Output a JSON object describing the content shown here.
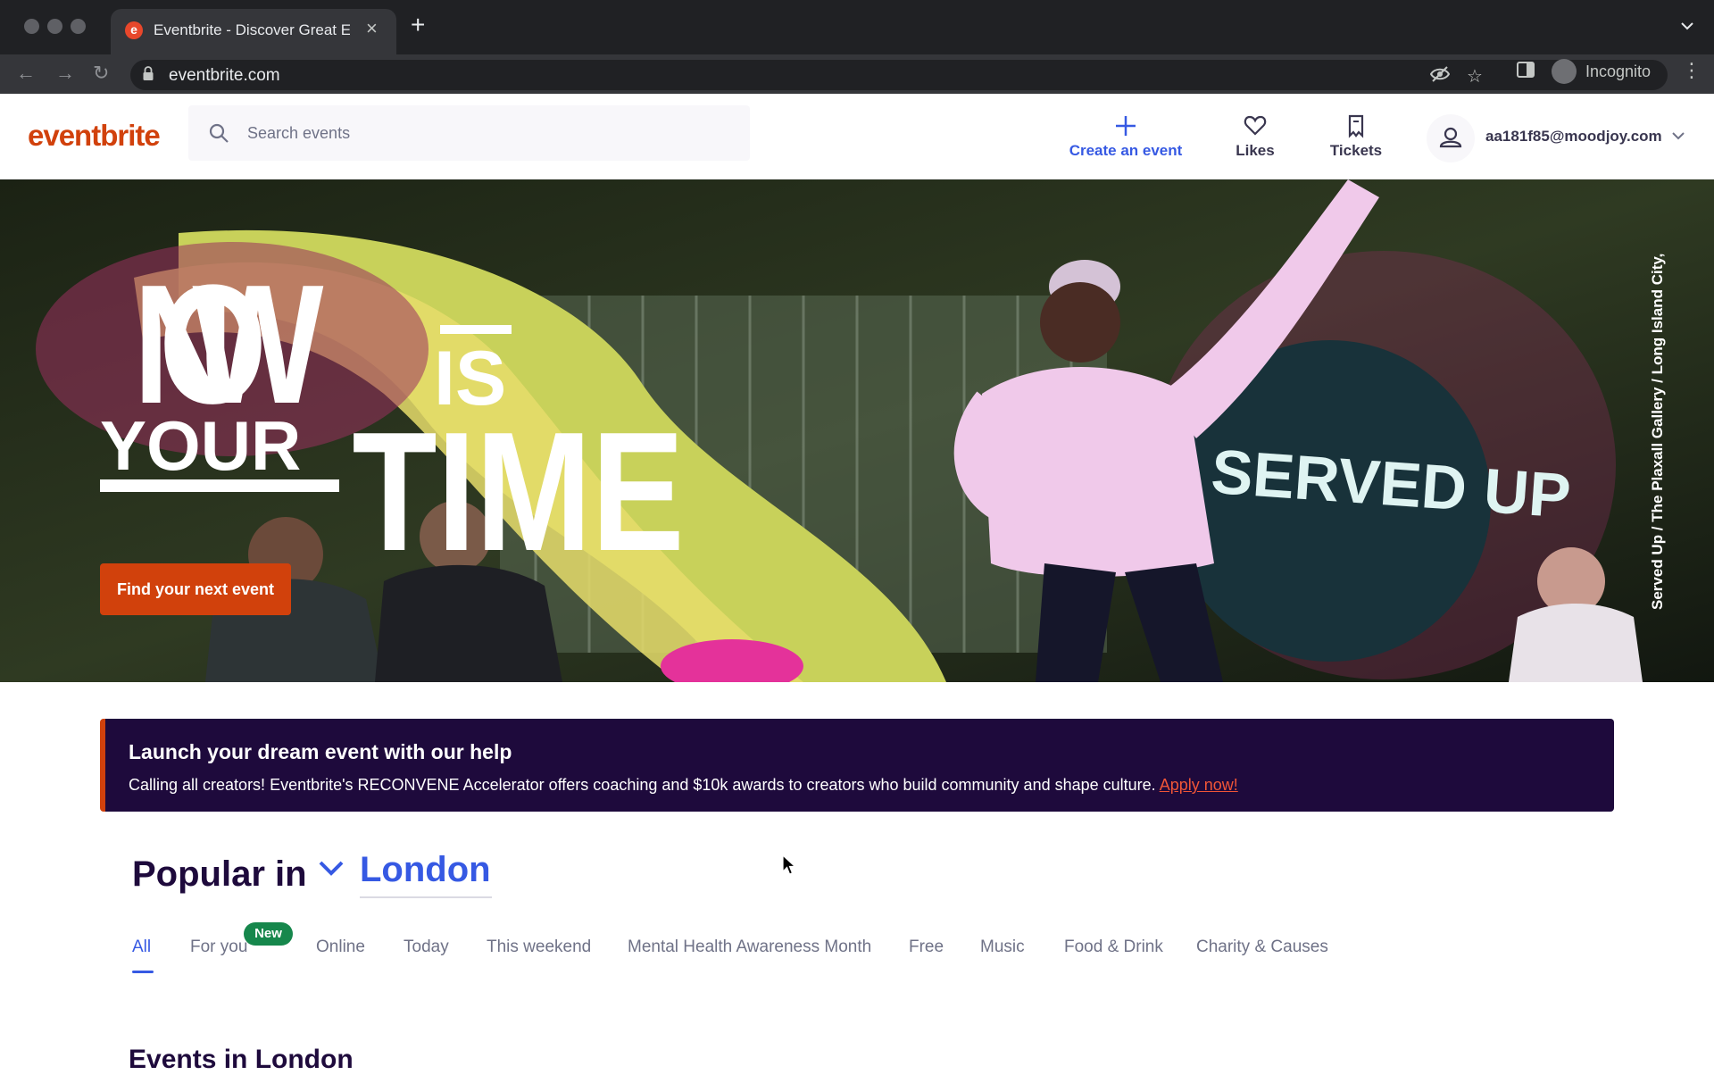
{
  "browser": {
    "tab_title": "Eventbrite - Discover Great Events",
    "url": "eventbrite.com",
    "incognito_label": "Incognito"
  },
  "header": {
    "logo": "eventbrite",
    "search_placeholder": "Search events",
    "create_label": "Create an event",
    "likes_label": "Likes",
    "tickets_label": "Tickets",
    "account_email": "aa181f85@moodjoy.com"
  },
  "hero": {
    "headline_now": "NOW",
    "headline_is": "IS",
    "headline_your": "YOUR",
    "headline_time": "TIME",
    "neon_sign": "SERVED UP",
    "cta_label": "Find your next event",
    "photo_credit": "Served Up / The Plaxall Gallery / Long Island City, NY"
  },
  "banner": {
    "title": "Launch your dream event with our help",
    "text": "Calling all creators! Eventbrite's RECONVENE Accelerator offers coaching and $10k awards to creators who build community and shape culture.",
    "link": "Apply now!"
  },
  "popular": {
    "title": "Popular in",
    "location": "London",
    "new_badge": "New",
    "tabs": [
      "All",
      "For you",
      "Online",
      "Today",
      "This weekend",
      "Mental Health Awareness Month",
      "Free",
      "Music",
      "Food & Drink",
      "Charity & Causes"
    ],
    "active_tab": "All"
  },
  "events": {
    "title": "Events in London"
  },
  "colors": {
    "brand_orange": "#d1410c",
    "accent_blue": "#3659e3",
    "banner_bg": "#1e0a3c",
    "new_badge_green": "#16874c"
  }
}
